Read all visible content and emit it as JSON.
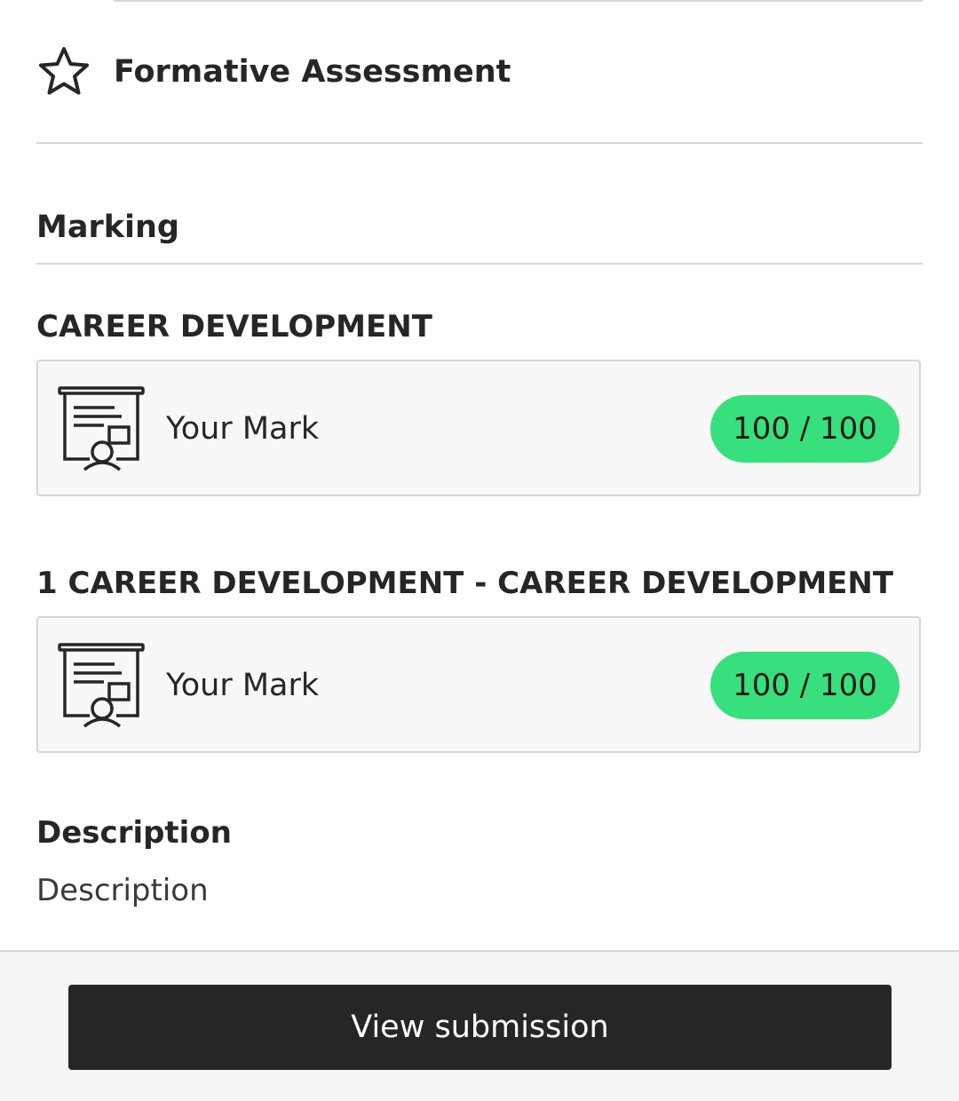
{
  "assessment": {
    "title": "Formative Assessment",
    "icon": "star-icon"
  },
  "marking": {
    "heading": "Marking",
    "groups": [
      {
        "title": "CAREER DEVELOPMENT",
        "label": "Your Mark",
        "score": "100 / 100",
        "icon": "presentation-icon"
      },
      {
        "title": "1 CAREER DEVELOPMENT - CAREER DEVELOPMENT",
        "label": "Your Mark",
        "score": "100 / 100",
        "icon": "presentation-icon"
      }
    ]
  },
  "description": {
    "heading": "Description",
    "text": "Description"
  },
  "footer": {
    "button_label": "View submission"
  },
  "colors": {
    "score_badge": "#37e07c",
    "button": "#262626",
    "text": "#262626"
  }
}
